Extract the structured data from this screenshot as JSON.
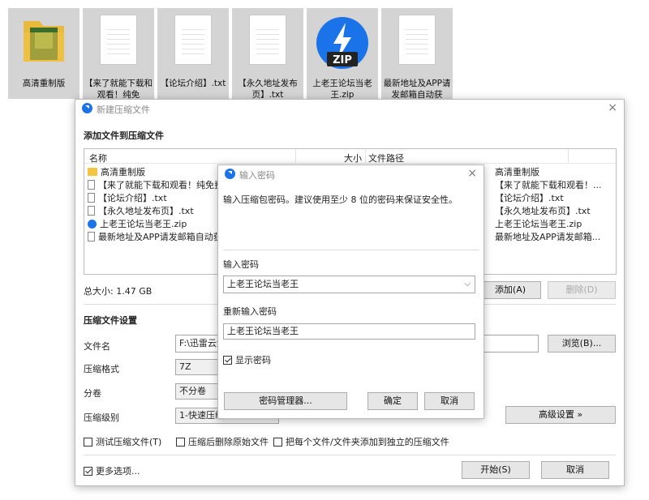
{
  "desktop": {
    "icons": [
      {
        "name": "高清重制版",
        "type": "folder"
      },
      {
        "name": "【来了就能下载和观看！纯免",
        "type": "doc"
      },
      {
        "name": "【论坛介绍】.txt",
        "type": "doc"
      },
      {
        "name": "【永久地址发布页】.txt",
        "type": "doc"
      },
      {
        "name": "上老王论坛当老王.zip",
        "type": "zip"
      },
      {
        "name": "最新地址及APP请发邮箱自动获",
        "type": "doc"
      }
    ],
    "zip_badge": "ZIP"
  },
  "main_dialog": {
    "title": "新建压缩文件",
    "close_glyph": "×",
    "section_add": "添加文件到压缩文件",
    "col_name": "名称",
    "col_size": "大小",
    "col_path": "文件路径",
    "files": [
      {
        "name": "高清重制版",
        "icon": "folder",
        "path": "高清重制版"
      },
      {
        "name": "【来了就能下载和观看！纯免费",
        "icon": "doc",
        "path": "【来了就能下载和观看！..."
      },
      {
        "name": "【论坛介绍】.txt",
        "icon": "doc",
        "path": "【论坛介绍】.txt"
      },
      {
        "name": "【永久地址发布页】.txt",
        "icon": "doc",
        "path": "【永久地址发布页】.txt"
      },
      {
        "name": "上老王论坛当老王.zip",
        "icon": "zip",
        "path": "上老王论坛当老王.zip"
      },
      {
        "name": "最新地址及APP请发邮箱自动获",
        "icon": "doc",
        "path": "最新地址及APP请发邮箱..."
      }
    ],
    "total_size": "总大小: 1.47 GB",
    "add_button": "添加(A)",
    "delete_button": "删除(D)",
    "settings_header": "压缩文件设置",
    "filename_label": "文件名",
    "filename_value": "F:\\迅雷云盘",
    "browse_button": "浏览(B)...",
    "format_label": "压缩格式",
    "format_value": "7Z",
    "split_label": "分卷",
    "split_value": "不分卷",
    "level_label": "压缩级别",
    "level_value": "1-快速压缩",
    "advanced_button": "高级设置 »",
    "test_check": "测试压缩文件(T)",
    "delete_after_check": "压缩后删除原始文件",
    "separate_check": "把每个文件/文件夹添加到独立的压缩文件",
    "more_options": "更多选项...",
    "start_button": "开始(S)",
    "cancel_button": "取消"
  },
  "password_dialog": {
    "title": "输入密码",
    "close_glyph": "×",
    "hint": "输入压缩包密码。建议使用至少 8 位的密码来保证安全性。",
    "password_label": "输入密码",
    "password_value": "上老王论坛当老王",
    "confirm_label": "重新输入密码",
    "confirm_value": "上老王论坛当老王",
    "show_password": "显示密码",
    "show_password_checked": true,
    "manager_button": "密码管理器...",
    "ok_button": "确定",
    "cancel_button": "取消"
  },
  "colors": {
    "accent": "#1a73e8",
    "folder": "#f5c542",
    "desktop_tile": "#d4d4d4"
  }
}
